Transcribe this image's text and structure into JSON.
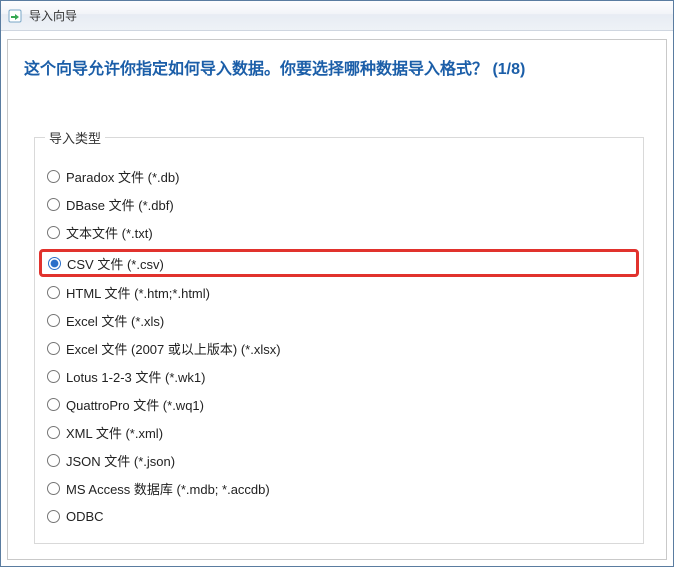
{
  "window": {
    "title": "导入向导",
    "icon_name": "import-wizard-icon"
  },
  "heading": "这个向导允许你指定如何导入数据。你要选择哪种数据导入格式？ (1/8)",
  "group": {
    "legend": "导入类型",
    "selected_index": 3,
    "highlight_index": 3,
    "options": [
      {
        "label": "Paradox 文件 (*.db)"
      },
      {
        "label": "DBase 文件 (*.dbf)"
      },
      {
        "label": "文本文件 (*.txt)"
      },
      {
        "label": "CSV 文件 (*.csv)"
      },
      {
        "label": "HTML 文件 (*.htm;*.html)"
      },
      {
        "label": "Excel 文件 (*.xls)"
      },
      {
        "label": "Excel 文件 (2007 或以上版本) (*.xlsx)"
      },
      {
        "label": "Lotus 1-2-3 文件 (*.wk1)"
      },
      {
        "label": "QuattroPro 文件 (*.wq1)"
      },
      {
        "label": "XML 文件 (*.xml)"
      },
      {
        "label": "JSON 文件 (*.json)"
      },
      {
        "label": "MS Access 数据库 (*.mdb; *.accdb)"
      },
      {
        "label": "ODBC"
      }
    ]
  }
}
